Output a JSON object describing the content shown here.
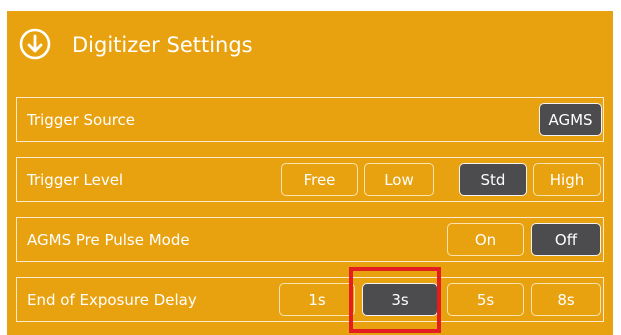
{
  "header": {
    "title": "Digitizer Settings",
    "icon": "arrow-down-circle-icon"
  },
  "rows": [
    {
      "label": "Trigger Source",
      "options": [
        {
          "label": "AGMS",
          "selected": true
        }
      ]
    },
    {
      "label": "Trigger Level",
      "options": [
        {
          "label": "Free",
          "selected": false
        },
        {
          "label": "Low",
          "selected": false
        },
        {
          "label": "Std",
          "selected": true
        },
        {
          "label": "High",
          "selected": false
        }
      ]
    },
    {
      "label": "AGMS Pre Pulse Mode",
      "options": [
        {
          "label": "On",
          "selected": false
        },
        {
          "label": "Off",
          "selected": true
        }
      ]
    },
    {
      "label": "End of Exposure Delay",
      "options": [
        {
          "label": "1s",
          "selected": false
        },
        {
          "label": "3s",
          "selected": true
        },
        {
          "label": "5s",
          "selected": false
        },
        {
          "label": "8s",
          "selected": false
        }
      ]
    }
  ],
  "colors": {
    "panel": "#e9a20f",
    "selected": "#4c4c4e",
    "highlight": "#e41d21"
  }
}
